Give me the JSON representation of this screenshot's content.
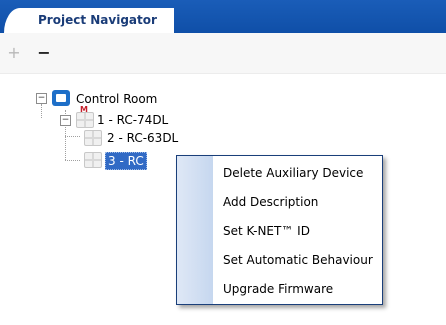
{
  "tab": {
    "title": "Project Navigator"
  },
  "toolbar": {
    "add_label": "+",
    "remove_label": "−"
  },
  "tree": {
    "root": {
      "label": "Control Room",
      "expander": "−"
    },
    "device1": {
      "label": "1 - RC-74DL",
      "expander": "−",
      "badge": "M"
    },
    "device2": {
      "label": "2 - RC-63DL"
    },
    "device3": {
      "label": "3 - RC"
    }
  },
  "context_menu": {
    "items": [
      "Delete Auxiliary Device",
      "Add Description",
      "Set K-NET™ ID",
      "Set Automatic Behaviour",
      "Upgrade Firmware"
    ]
  },
  "colors": {
    "tabbar": "#1a5db8",
    "selection": "#316ac5",
    "menu_border": "#1a3f7a"
  }
}
